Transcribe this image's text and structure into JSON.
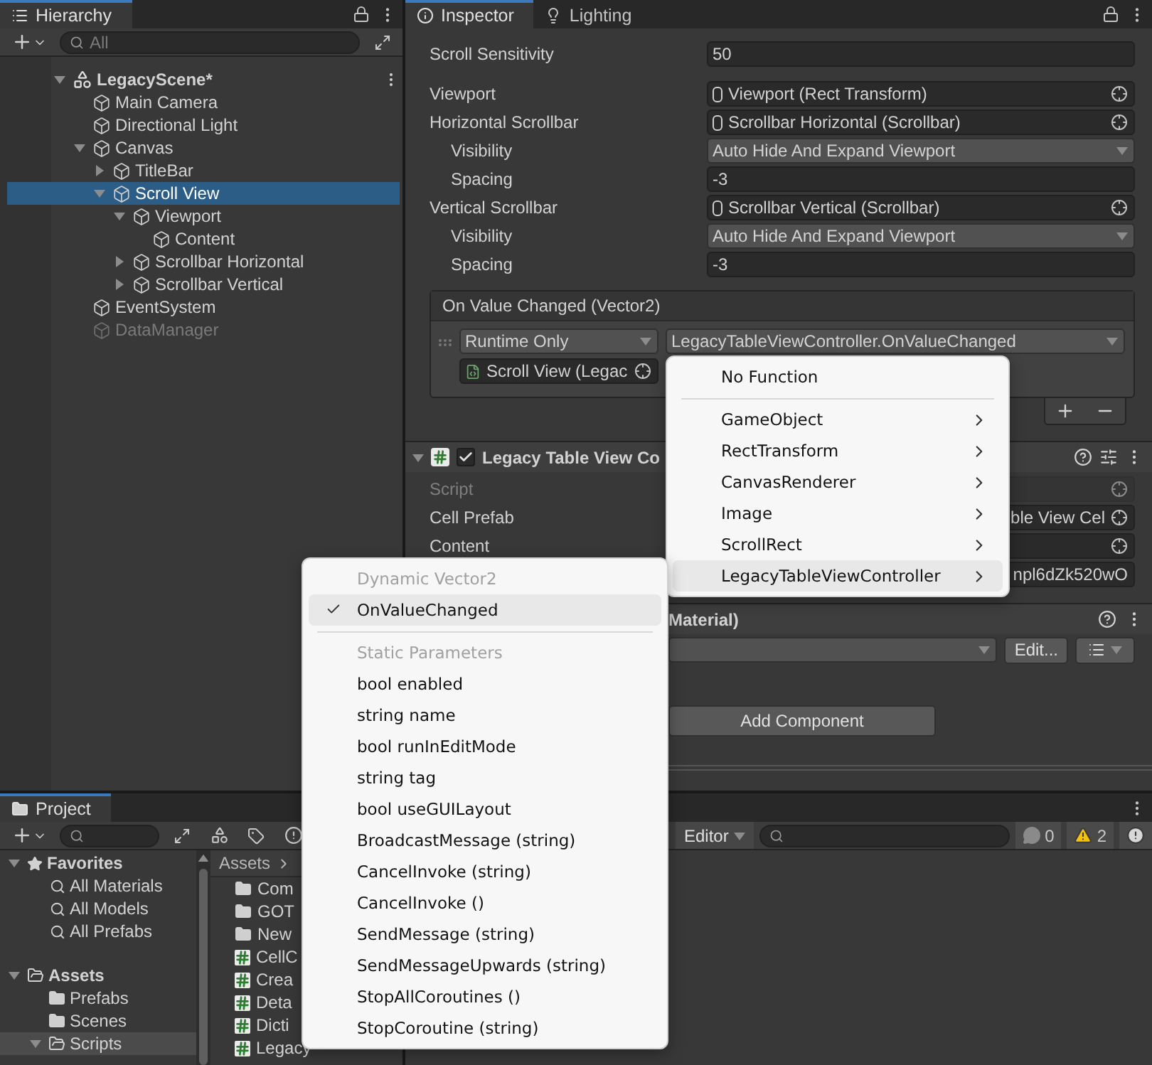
{
  "hierarchy": {
    "title": "Hierarchy",
    "search": {
      "placeholder": "All"
    },
    "scene": {
      "name": "LegacyScene*",
      "expanded": true,
      "children": [
        {
          "name": "Main Camera",
          "selected": false,
          "disabled": false
        },
        {
          "name": "Directional Light",
          "selected": false,
          "disabled": false
        },
        {
          "name": "Canvas",
          "selected": false,
          "disabled": false,
          "expanded": true,
          "children": [
            {
              "name": "TitleBar",
              "selected": false,
              "disabled": false,
              "expanded": false
            },
            {
              "name": "Scroll View",
              "selected": true,
              "disabled": false,
              "expanded": true,
              "children": [
                {
                  "name": "Viewport",
                  "selected": false,
                  "disabled": false,
                  "expanded": true,
                  "children": [
                    {
                      "name": "Content",
                      "selected": false,
                      "disabled": false
                    }
                  ]
                },
                {
                  "name": "Scrollbar Horizontal",
                  "selected": false,
                  "disabled": false,
                  "expanded": false
                },
                {
                  "name": "Scrollbar Vertical",
                  "selected": false,
                  "disabled": false,
                  "expanded": false
                }
              ]
            }
          ]
        },
        {
          "name": "EventSystem",
          "selected": false,
          "disabled": false
        },
        {
          "name": "DataManager",
          "selected": false,
          "disabled": true
        }
      ]
    }
  },
  "inspector": {
    "tabs": [
      {
        "label": "Inspector",
        "selected": true
      },
      {
        "label": "Lighting",
        "selected": false
      }
    ],
    "groups": [
      [
        {
          "kind": "text",
          "label": "Scroll Sensitivity",
          "value": "50"
        }
      ],
      [
        {
          "kind": "object",
          "label": "Viewport",
          "value": "Viewport (Rect Transform)"
        },
        {
          "kind": "object",
          "label": "Horizontal Scrollbar",
          "value": "Scrollbar Horizontal (Scrollbar)",
          "children": [
            {
              "kind": "dropdown",
              "label": "Visibility",
              "value": "Auto Hide And Expand Viewport"
            },
            {
              "kind": "text",
              "label": "Spacing",
              "value": "-3"
            }
          ]
        },
        {
          "kind": "object",
          "label": "Vertical Scrollbar",
          "value": "Scrollbar Vertical (Scrollbar)",
          "children": [
            {
              "kind": "dropdown",
              "label": "Visibility",
              "value": "Auto Hide And Expand Viewport"
            },
            {
              "kind": "text",
              "label": "Spacing",
              "value": "-3"
            }
          ]
        }
      ]
    ],
    "event": {
      "title": "On Value Changed (Vector2)",
      "mode": "Runtime Only",
      "function": "LegacyTableViewController.OnValueChanged",
      "target": "Scroll View (Legac"
    },
    "component": {
      "title": "Legacy Table View Co",
      "enabled": true,
      "expanded": true,
      "fields": [
        {
          "kind": "object",
          "label": "Script",
          "disabled": true
        },
        {
          "kind": "object",
          "label": "Cell Prefab",
          "value": "ble View Cel",
          "disabled": false
        },
        {
          "kind": "object",
          "label": "Content",
          "disabled": false
        },
        {
          "kind": "text",
          "value": "npl6dZk520wO",
          "disabled": false
        }
      ]
    },
    "material": {
      "title": "Material)",
      "button": "Edit..."
    },
    "add_component": "Add Component"
  },
  "project": {
    "title": "Project",
    "favorites": {
      "label": "Favorites",
      "expanded": true,
      "children": [
        "All Materials",
        "All Models",
        "All Prefabs"
      ]
    },
    "assets": {
      "label": "Assets",
      "expanded": true,
      "children": [
        {
          "label": "Prefabs",
          "selected": false
        },
        {
          "label": "Scenes",
          "selected": false
        },
        {
          "label": "Scripts",
          "selected": true,
          "expanded": true
        }
      ]
    },
    "breadcrumb": "Assets",
    "files": [
      {
        "name": "Com",
        "kind": "folder"
      },
      {
        "name": "GOT",
        "kind": "folder"
      },
      {
        "name": "New",
        "kind": "folder"
      },
      {
        "name": "CellC",
        "kind": "script"
      },
      {
        "name": "Crea",
        "kind": "script"
      },
      {
        "name": "Deta",
        "kind": "script"
      },
      {
        "name": "Dicti",
        "kind": "script"
      },
      {
        "name": "Legacy",
        "kind": "script"
      }
    ]
  },
  "console": {
    "filter": "Editor",
    "counts": [
      {
        "kind": "info",
        "count": "0"
      },
      {
        "kind": "warning",
        "count": "2"
      },
      {
        "kind": "error"
      }
    ]
  },
  "function_menu": {
    "items": [
      {
        "kind": "item",
        "label": "No Function",
        "submenu": false,
        "selected": false
      },
      {
        "kind": "separator"
      },
      {
        "kind": "item",
        "label": "GameObject",
        "submenu": true,
        "selected": false
      },
      {
        "kind": "item",
        "label": "RectTransform",
        "submenu": true,
        "selected": false
      },
      {
        "kind": "item",
        "label": "CanvasRenderer",
        "submenu": true,
        "selected": false
      },
      {
        "kind": "item",
        "label": "Image",
        "submenu": true,
        "selected": false
      },
      {
        "kind": "item",
        "label": "ScrollRect",
        "submenu": true,
        "selected": false
      },
      {
        "kind": "item",
        "label": "LegacyTableViewController",
        "submenu": true,
        "selected": true
      }
    ]
  },
  "method_menu": {
    "items": [
      {
        "kind": "header",
        "label": "Dynamic Vector2"
      },
      {
        "kind": "item",
        "label": "OnValueChanged",
        "checked": true
      },
      {
        "kind": "separator"
      },
      {
        "kind": "header",
        "label": "Static Parameters"
      },
      {
        "kind": "item",
        "label": "bool enabled",
        "checked": false
      },
      {
        "kind": "item",
        "label": "string name",
        "checked": false
      },
      {
        "kind": "item",
        "label": "bool runInEditMode",
        "checked": false
      },
      {
        "kind": "item",
        "label": "string tag",
        "checked": false
      },
      {
        "kind": "item",
        "label": "bool useGUILayout",
        "checked": false
      },
      {
        "kind": "item",
        "label": "BroadcastMessage (string)",
        "checked": false
      },
      {
        "kind": "item",
        "label": "CancelInvoke (string)",
        "checked": false
      },
      {
        "kind": "item",
        "label": "CancelInvoke ()",
        "checked": false
      },
      {
        "kind": "item",
        "label": "SendMessage (string)",
        "checked": false
      },
      {
        "kind": "item",
        "label": "SendMessageUpwards (string)",
        "checked": false
      },
      {
        "kind": "item",
        "label": "StopAllCoroutines ()",
        "checked": false
      },
      {
        "kind": "item",
        "label": "StopCoroutine (string)",
        "checked": false
      }
    ]
  }
}
